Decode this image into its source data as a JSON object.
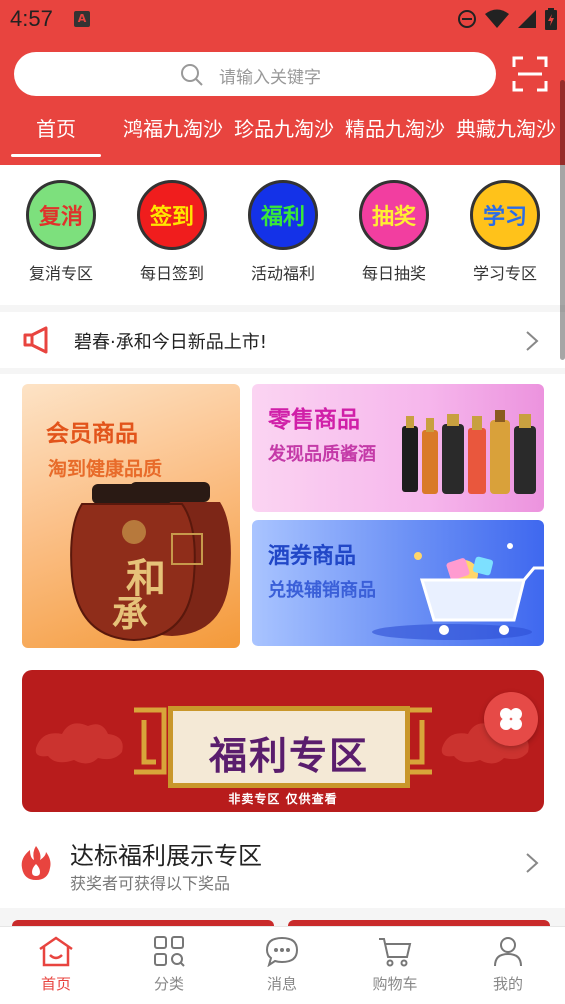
{
  "status_bar": {
    "time": "4:57",
    "app_badge": "A"
  },
  "search": {
    "placeholder": "请输入关键字"
  },
  "tabs": [
    {
      "label": "首页",
      "active": true
    },
    {
      "label": "鸿福九淘沙"
    },
    {
      "label": "珍品九淘沙"
    },
    {
      "label": "精品九淘沙"
    },
    {
      "label": "典藏九淘沙"
    }
  ],
  "categories": [
    {
      "badge": "复消",
      "label": "复消专区",
      "bg": "#7de07d",
      "fg": "#e0322b"
    },
    {
      "badge": "签到",
      "label": "每日签到",
      "bg": "#f01d1d",
      "fg": "#ffe600"
    },
    {
      "badge": "福利",
      "label": "活动福利",
      "bg": "#1432e8",
      "fg": "#39e839"
    },
    {
      "badge": "抽奖",
      "label": "每日抽奖",
      "bg": "#f23ea0",
      "fg": "#ffee33"
    },
    {
      "badge": "学习",
      "label": "学习专区",
      "bg": "#ffc21a",
      "fg": "#2a6ce8"
    }
  ],
  "notice": {
    "text": "碧春·承和今日新品上市!"
  },
  "promos": {
    "member": {
      "title": "会员商品",
      "subtitle": "淘到健康品质"
    },
    "retail": {
      "title": "零售商品",
      "subtitle": "发现品质酱酒"
    },
    "voucher": {
      "title": "酒券商品",
      "subtitle": "兑换辅销商品"
    }
  },
  "banner": {
    "title": "福利专区",
    "subtitle": "非卖专区  仅供查看"
  },
  "section": {
    "title": "达标福利展示专区",
    "subtitle": "获奖者可获得以下奖品"
  },
  "bottom_nav": [
    {
      "label": "首页",
      "icon": "home-icon",
      "active": true
    },
    {
      "label": "分类",
      "icon": "category-icon"
    },
    {
      "label": "消息",
      "icon": "message-icon"
    },
    {
      "label": "购物车",
      "icon": "cart-icon"
    },
    {
      "label": "我的",
      "icon": "profile-icon"
    }
  ],
  "colors": {
    "brand": "#e8443f",
    "nav_inactive": "#888888"
  }
}
